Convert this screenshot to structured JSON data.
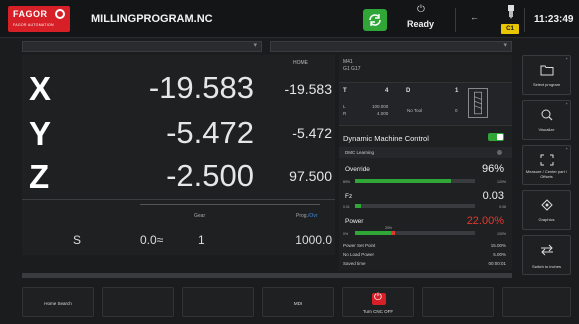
{
  "header": {
    "brand": "FAGOR",
    "brand_sub": "FAGOR AUTOMATION",
    "program_name": "MILLINGPROGRAM.NC",
    "status": "Ready",
    "channel": "C1",
    "time": "11:23:49",
    "cycle_color": "#2fa636",
    "brand_color": "#d61f26",
    "channel_color": "#e8c600"
  },
  "axes": {
    "home_label": "HOME",
    "items": [
      {
        "letter": "X",
        "value": "-19.583",
        "secondary": "-19.583"
      },
      {
        "letter": "Y",
        "value": "-5.472",
        "secondary": "-5.472"
      },
      {
        "letter": "Z",
        "value": "-2.500",
        "secondary": "97.500"
      }
    ]
  },
  "spindle": {
    "gear_label": "Gear",
    "prog_label": "Prog.",
    "prog_label_suffix": "/Ovr",
    "letter": "S",
    "speed": "0.0≈",
    "gear": "1",
    "feed": "1000.0"
  },
  "status_panel": {
    "line1": "M41",
    "line2": "G1 G17"
  },
  "tool": {
    "t_label": "T",
    "t_value": "4",
    "d_label": "D",
    "d_value": "1",
    "l_label": "L",
    "l_value": "100.000",
    "r_label": "R",
    "r_value": "4.000",
    "no_tool": "No Tool",
    "count": "0"
  },
  "dmc": {
    "label": "Dynamic Machine Control",
    "enabled": true,
    "learning_label": "DMC Learning"
  },
  "meters": [
    {
      "label": "Override",
      "value": "96%",
      "min": "80%",
      "max": "120%",
      "fill_fraction": 0.8,
      "color": "#2fa636",
      "value_color": "#f0f0f0"
    },
    {
      "label": "Fz",
      "value": "0.03",
      "min": "0.01",
      "max": "0.06",
      "fill_fraction": 0.05,
      "color": "#2fa636",
      "value_color": "#f0f0f0"
    },
    {
      "label": "Power",
      "value": "22.00%",
      "min": "0%",
      "max": "100%",
      "fill_fraction": 0.33,
      "color": "#2fa636",
      "value_color": "#e03a30",
      "mid_label": "20%"
    }
  ],
  "footer_stats": [
    {
      "label": "Power Set Point",
      "value": "15.00%"
    },
    {
      "label": "No Load Power",
      "value": "5.00%"
    },
    {
      "label": "Saved time",
      "value": "00:00:01"
    }
  ],
  "side_keys": [
    {
      "label": "Select program",
      "icon": "folder-icon"
    },
    {
      "label": "Visualize",
      "icon": "magnifier-icon"
    },
    {
      "label": "Measure / Center part / Offsets",
      "icon": "measure-icon"
    },
    {
      "label": "Graphics",
      "icon": "graphics-icon"
    },
    {
      "label": "Switch to inches",
      "icon": "switch-arrows-icon"
    }
  ],
  "soft_keys": [
    {
      "label": "Home Search"
    },
    {
      "label": ""
    },
    {
      "label": ""
    },
    {
      "label": "MDI"
    },
    {
      "label": "Turn CNC OFF"
    },
    {
      "label": ""
    },
    {
      "label": ""
    }
  ]
}
